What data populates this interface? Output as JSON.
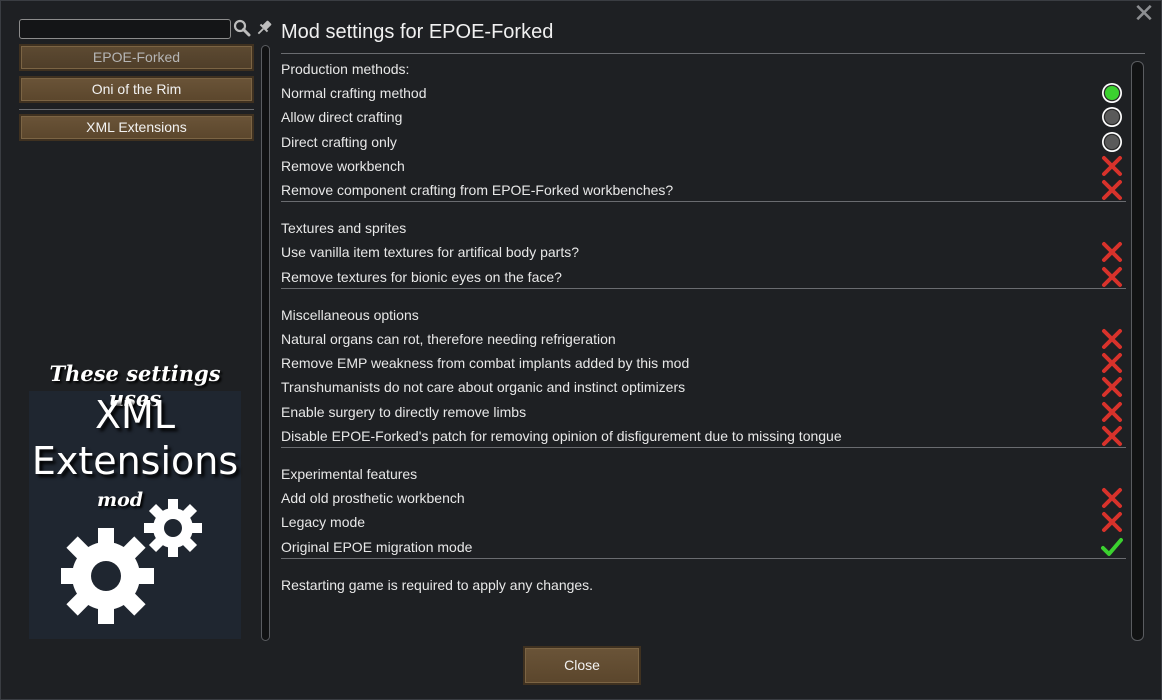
{
  "window": {
    "title": "Mod settings for EPOE-Forked",
    "close_glyph": "✕"
  },
  "sidebar": {
    "search": {
      "value": "",
      "placeholder": ""
    },
    "mods": [
      {
        "label": "EPOE-Forked",
        "active": true
      },
      {
        "label": "Oni of the Rim",
        "active": false
      },
      {
        "label": "XML Extensions",
        "active": false
      }
    ],
    "banner": {
      "line1": "These settings uses",
      "line2": "XML",
      "line3": "Extensions",
      "line4": "mod",
      "icon": "gears-icon"
    }
  },
  "sections": [
    {
      "heading": "Production methods:",
      "settings": [
        {
          "label": "Normal crafting method",
          "control": "radio",
          "state": "selected"
        },
        {
          "label": "Allow direct crafting",
          "control": "radio",
          "state": "unselected"
        },
        {
          "label": "Direct crafting only",
          "control": "radio",
          "state": "unselected"
        },
        {
          "label": "Remove workbench",
          "control": "checkbox",
          "state": "off"
        },
        {
          "label": "Remove component crafting from EPOE-Forked workbenches?",
          "control": "checkbox",
          "state": "off"
        }
      ]
    },
    {
      "heading": "Textures and sprites",
      "settings": [
        {
          "label": "Use vanilla item textures for artifical body parts?",
          "control": "checkbox",
          "state": "off"
        },
        {
          "label": "Remove textures for bionic eyes on the face?",
          "control": "checkbox",
          "state": "off"
        }
      ]
    },
    {
      "heading": "Miscellaneous options",
      "settings": [
        {
          "label": "Natural organs can rot, therefore needing refrigeration",
          "control": "checkbox",
          "state": "off"
        },
        {
          "label": "Remove EMP weakness from combat implants added by this mod",
          "control": "checkbox",
          "state": "off"
        },
        {
          "label": "Transhumanists do not care about organic and instinct optimizers",
          "control": "checkbox",
          "state": "off"
        },
        {
          "label": "Enable surgery to directly remove limbs",
          "control": "checkbox",
          "state": "off"
        },
        {
          "label": "Disable EPOE-Forked's patch for removing opinion of disfigurement due to missing tongue",
          "control": "checkbox",
          "state": "off"
        }
      ]
    },
    {
      "heading": "Experimental features",
      "settings": [
        {
          "label": "Add old prosthetic workbench",
          "control": "checkbox",
          "state": "off"
        },
        {
          "label": "Legacy mode",
          "control": "checkbox",
          "state": "off"
        },
        {
          "label": "Original EPOE migration mode",
          "control": "checkbox",
          "state": "on"
        }
      ]
    }
  ],
  "footer_note": "Restarting game is required to apply any changes.",
  "close_button_label": "Close",
  "colors": {
    "radio_selected": "#3bd12f",
    "radio_unselected": "#5a5a5a",
    "check_on": "#3bd12f",
    "check_off": "#d8322b",
    "button_brown": "#5f4a30"
  }
}
